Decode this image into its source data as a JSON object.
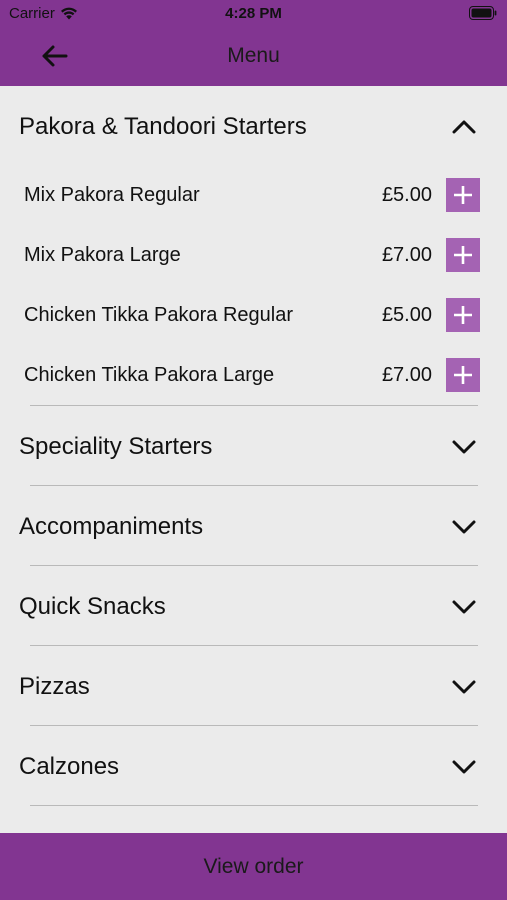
{
  "status_bar": {
    "carrier": "Carrier",
    "time": "4:28 PM"
  },
  "nav": {
    "title": "Menu"
  },
  "open_section": {
    "title": "Pakora & Tandoori Starters",
    "items": [
      {
        "name": "Mix Pakora Regular",
        "price": "£5.00"
      },
      {
        "name": "Mix Pakora Large",
        "price": "£7.00"
      },
      {
        "name": "Chicken Tikka Pakora Regular",
        "price": "£5.00"
      },
      {
        "name": "Chicken Tikka Pakora Large",
        "price": "£7.00"
      }
    ]
  },
  "collapsed_sections": [
    {
      "title": "Speciality Starters"
    },
    {
      "title": "Accompaniments"
    },
    {
      "title": "Quick Snacks"
    },
    {
      "title": "Pizzas"
    },
    {
      "title": "Calzones"
    }
  ],
  "footer": {
    "label": "View order"
  },
  "colors": {
    "brand": "#823591",
    "add_button": "#a463b3",
    "background": "#ebebeb"
  }
}
